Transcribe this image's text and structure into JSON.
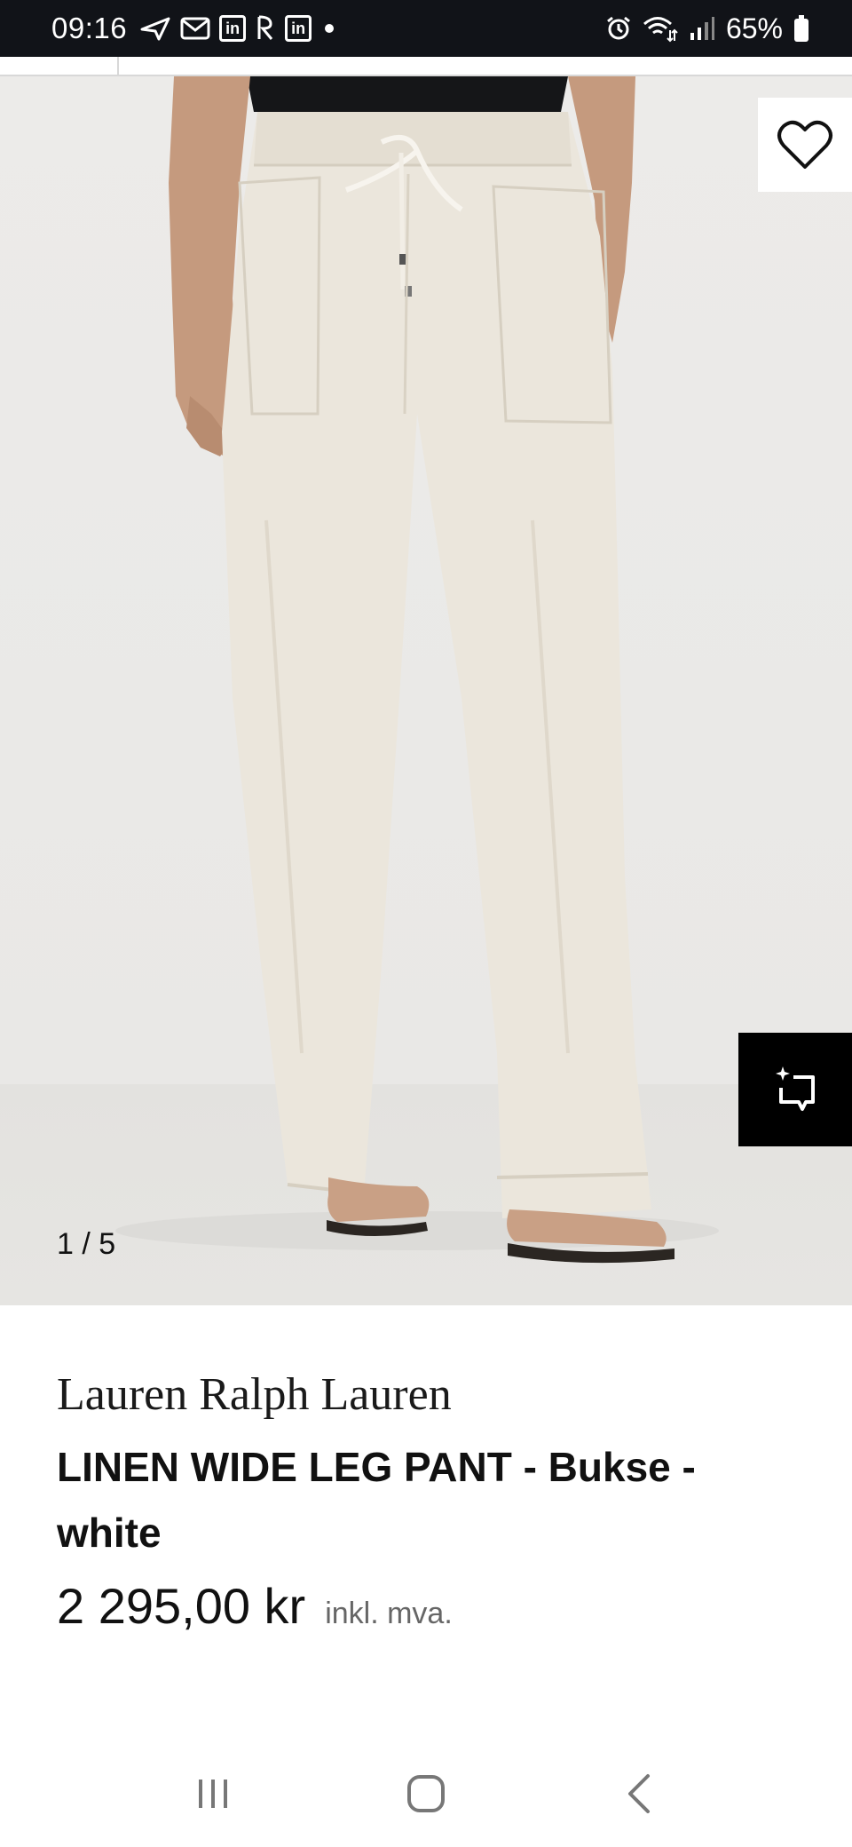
{
  "status_bar": {
    "time": "09:16",
    "left_icons": [
      "navigation-arrow-icon",
      "mail-icon",
      "linkedin-icon",
      "notification-app-icon",
      "linkedin-icon",
      "dot-icon"
    ],
    "linkedin_label": "in",
    "battery": "65%"
  },
  "gallery": {
    "counter": "1 / 5",
    "favorite_icon": "heart-icon",
    "similar_icon": "similar-items-icon"
  },
  "product": {
    "brand": "Lauren Ralph Lauren",
    "name": "LINEN WIDE LEG PANT - Bukse - white",
    "price": "2 295,00 kr",
    "vat_note": "inkl. mva."
  },
  "nav": {
    "recents_icon": "recent-apps-icon",
    "home_icon": "home-icon",
    "back_icon": "back-icon"
  },
  "colors": {
    "status_bar": "#111318",
    "accent_dark": "#000000",
    "image_bg": "#ecebe9",
    "text": "#111111",
    "muted": "#666666"
  }
}
